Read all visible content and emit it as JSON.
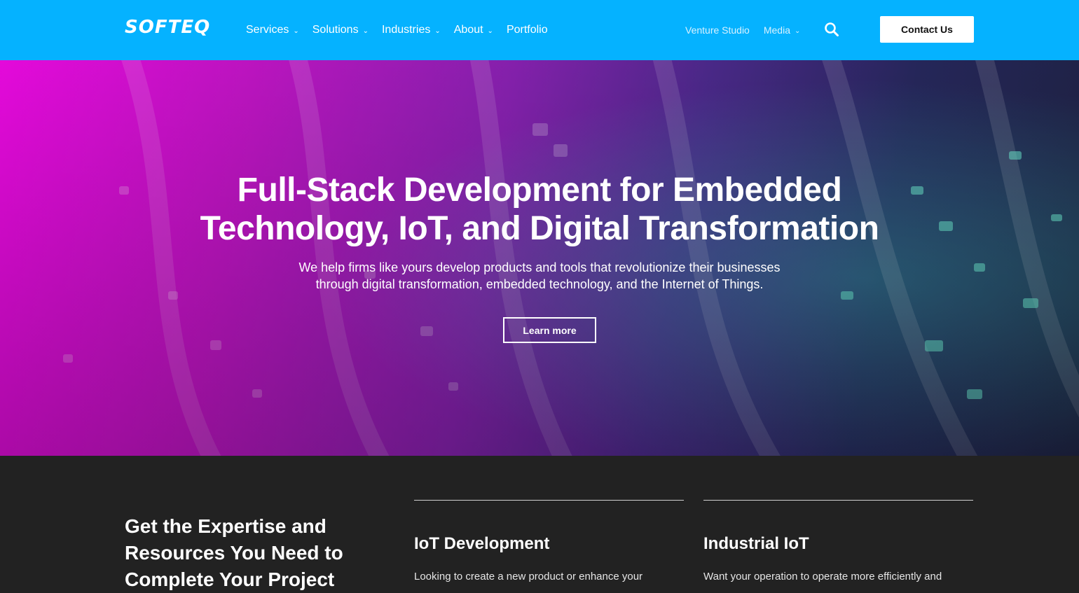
{
  "header": {
    "logo": "SOFTEQ",
    "nav": [
      {
        "label": "Services",
        "icon": "chevron-down-icon"
      },
      {
        "label": "Solutions",
        "icon": "chevron-down-icon"
      },
      {
        "label": "Industries",
        "icon": "chevron-down-icon"
      },
      {
        "label": "About",
        "icon": "chevron-down-icon"
      },
      {
        "label": "Portfolio"
      }
    ],
    "secondary_nav": [
      {
        "label": "Venture Studio"
      },
      {
        "label": "Media",
        "icon": "chevron-down-icon"
      }
    ],
    "search_icon": "search-icon",
    "contact_label": "Contact Us",
    "colors": {
      "bar": "#05b2ff"
    }
  },
  "hero": {
    "title_line1": "Full-Stack Development for Embedded",
    "title_line2": "Technology, IoT, and Digital Transformation",
    "subtitle_line1": "We help firms like yours develop products and tools that revolutionize their businesses",
    "subtitle_line2": "through digital transformation, embedded technology, and the Internet of Things.",
    "cta_label": "Learn more"
  },
  "section": {
    "heading_line1": "Get the Expertise and",
    "heading_line2": "Resources You Need to",
    "heading_line3": "Complete Your Project",
    "cards": [
      {
        "title": "IoT Development",
        "text": "Looking to create a new product or enhance your"
      },
      {
        "title": "Industrial IoT",
        "text": "Want your operation to operate more efficiently and"
      }
    ]
  }
}
